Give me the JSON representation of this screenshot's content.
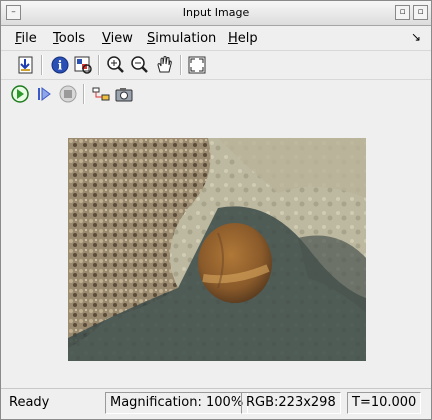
{
  "window": {
    "title": "Input Image"
  },
  "menu": {
    "items": [
      {
        "first": "F",
        "rest": "ile"
      },
      {
        "first": "T",
        "rest": "ools"
      },
      {
        "first": "V",
        "rest": "iew"
      },
      {
        "first": "S",
        "rest": "imulation"
      },
      {
        "first": "H",
        "rest": "elp"
      }
    ],
    "corner_icon": "↘"
  },
  "toolbar1": {
    "icons": [
      "import-image-icon",
      "info-icon",
      "pixel-region-icon",
      "zoom-in-icon",
      "zoom-out-icon",
      "pan-hand-icon",
      "fit-to-window-icon"
    ]
  },
  "toolbar2": {
    "icons": [
      "run-icon",
      "step-forward-icon",
      "stop-icon",
      "go-to-parent-icon",
      "snapshot-camera-icon"
    ]
  },
  "image": {
    "description_width": 298,
    "description_height": 223
  },
  "status": {
    "ready": "Ready",
    "magnification": "Magnification: 100%",
    "rgb": "RGB:223x298",
    "time": "T=10.000"
  },
  "colors": {
    "window_bg": "#efefef",
    "accent_green": "#2e9a2e",
    "accent_blue": "#3a5bc7"
  }
}
